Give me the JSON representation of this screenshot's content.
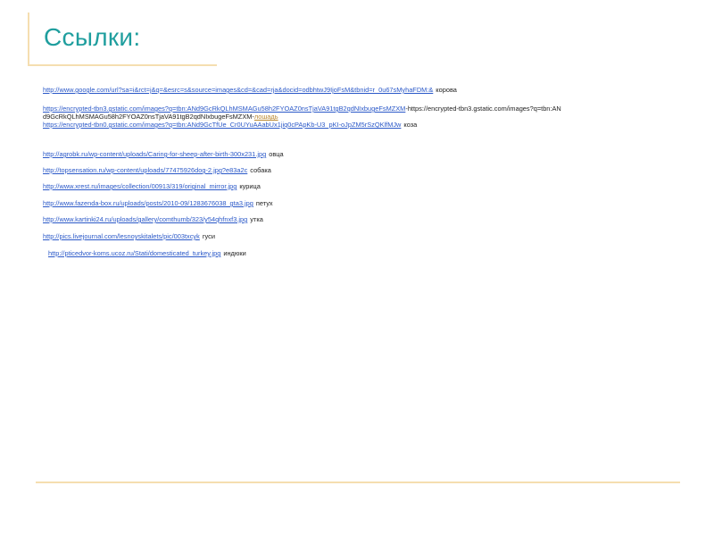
{
  "slide": {
    "title": "Ссылки:"
  },
  "references": [
    {
      "url": "http://www.google.com/url?sa=i&rct=j&q=&esrc=s&source=images&cd=&cad=rja&docid=odbhtwJ9IjoFsM&tbnid=r_0u67sMyhaFDM:&",
      "label": "корова"
    },
    {
      "line1_url": "https://encrypted-tbn3.gstatic.com/images?q=tbn:ANd9GcRkQLhMSMAGu58h2FYOAZ0nsTjaVA91tgB2qdNIxbugeFsMZXM",
      "line1_sep": "-",
      "line1_text": "https://encrypted-tbn3.gstatic.com/images?q=tbn:AN",
      "line2_text": "d9GcRkQLhMSMAGu58h2FYOAZ0nsTjaVA91tgB2qdNIxbugeFsMZXM-",
      "line2_link": "лошадь",
      "line3_url": "https://encrypted-tbn0.gstatic.com/images?q=tbn:ANd9GcTfUe_Cr0UYuAAabUx1jiq0cPApKb-U3_pKI-oJpZM5rSzQKlfMJw",
      "line3_label": "коза"
    },
    {
      "url": "http://agrobk.ru/wp-content/uploads/Caring-for-sheep-after-birth-300x231.jpg",
      "label": "овца"
    },
    {
      "url": "http://topsensation.ru/wp-content/uploads/77475926dog-2.jpg?e83a2c",
      "label": "собака"
    },
    {
      "url": "http://www.xrest.ru/images/collection/00913/319/original_mirror.jpg",
      "label": "курица"
    },
    {
      "url": "http://www.fazenda-box.ru/uploads/posts/2010-09/1283676038_gta3.jpg",
      "label": "петух"
    },
    {
      "url": "http://www.kartinki24.ru/uploads/gallery/comthumb/323/y54qhfnxf3.jpg",
      "label": "утка"
    },
    {
      "url": "http://pics.livejournal.com/lesnoyskitalets/pic/003txcyk",
      "label": "гуси"
    },
    {
      "url": "http://pticedvor-koms.ucoz.ru/Stati/domesticated_turkey.jpg",
      "label": "индюки"
    }
  ]
}
